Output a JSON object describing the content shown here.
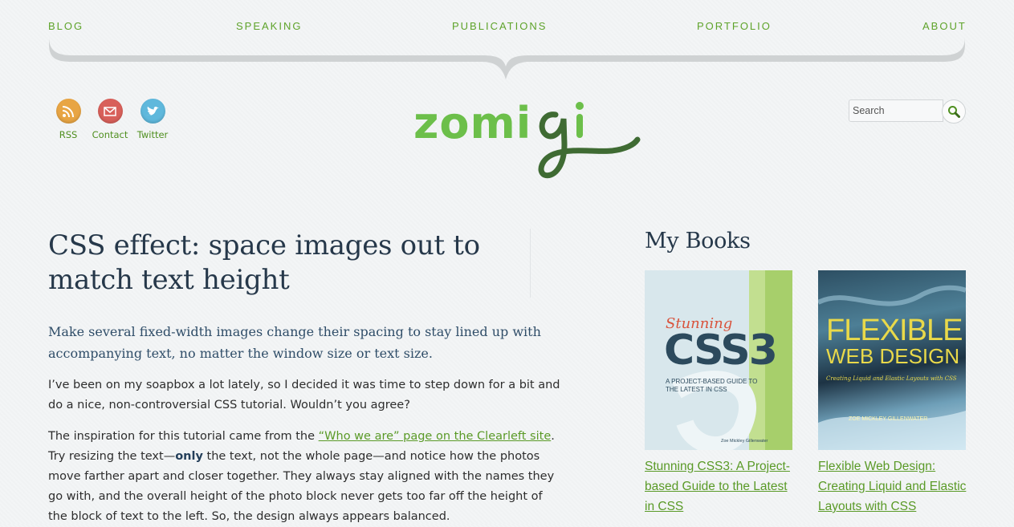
{
  "nav": {
    "items": [
      "BLOG",
      "SPEAKING",
      "PUBLICATIONS",
      "PORTFOLIO",
      "ABOUT"
    ]
  },
  "social": {
    "rss": {
      "label": "RSS",
      "icon": "rss-icon",
      "color": "#e8a544"
    },
    "contact": {
      "label": "Contact",
      "icon": "mail-icon",
      "color": "#d8605a"
    },
    "twitter": {
      "label": "Twitter",
      "icon": "twitter-bird-icon",
      "color": "#5fb8dc"
    }
  },
  "logo": {
    "text": "zomigi"
  },
  "search": {
    "placeholder": "Search",
    "icon": "search-icon"
  },
  "article": {
    "title": "CSS effect: space images out to match text height",
    "lede": "Make several fixed-width images change their spacing to stay lined up with accompanying text, no matter the window size or text size.",
    "p1": "I’ve been on my soapbox a lot lately, so I decided it was time to step down for a bit and do a nice, non-controversial CSS tutorial. Wouldn’t you agree?",
    "p2_before": "The inspiration for this tutorial came from the ",
    "p2_link": "“Who we are” page on the Clearleft site",
    "p2_mid1": ". Try resizing the text—",
    "p2_strong": "only",
    "p2_after": " the text, not the whole page—and notice how the photos move farther apart and closer together. They always stay aligned with the names they go with, and the overall height of the photo block never gets too far off the height of the block of text to the left. So, the design always appears balanced."
  },
  "sidebar": {
    "title": "My Books",
    "books": [
      {
        "cover_title_1": "Stunning",
        "cover_title_2": "CSS3",
        "cover_sub": "A PROJECT-BASED GUIDE TO THE LATEST IN CSS",
        "cover_author": "Zoe Mickley Gillenwater",
        "link": "Stunning CSS3: A Project-based Guide to the Latest in CSS"
      },
      {
        "cover_title_1": "FLEXIBLE",
        "cover_title_2": "WEB DESIGN",
        "cover_sub": "Creating Liquid and Elastic Layouts with CSS",
        "cover_author": "ZOE MICKLEY GILLENWATER",
        "link": "Flexible Web Design: Creating Liquid and Elastic Layouts with CSS"
      }
    ]
  },
  "colors": {
    "accent": "#5ea32a",
    "heading": "#26384a",
    "lede": "#2f4d68",
    "logo_light": "#6cbf4a",
    "logo_dark": "#3f6b33"
  }
}
